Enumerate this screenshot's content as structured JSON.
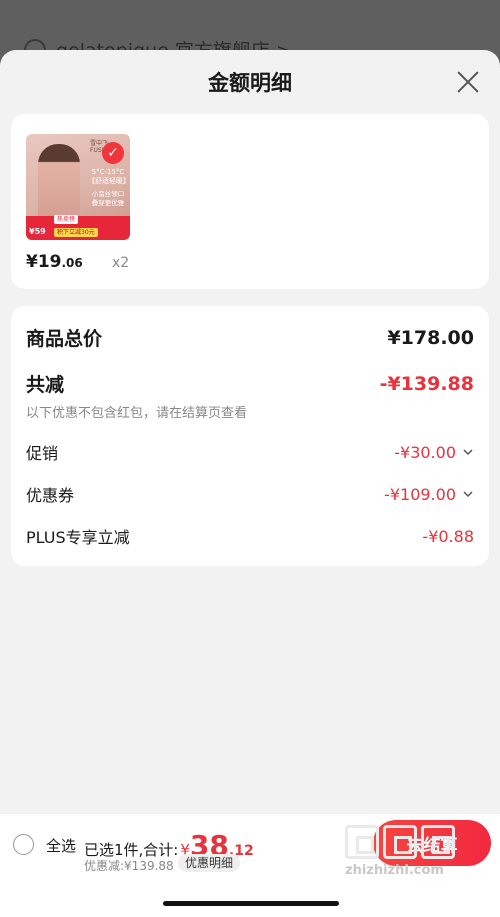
{
  "background": {
    "store_name": "gelatopique 官方旗舰店 >"
  },
  "sheet": {
    "title": "金额明细"
  },
  "product": {
    "thumbnail": {
      "brand": "雪中飞 FUSIRAGE",
      "temp": "5°C-15°C 【舒适轻暖】",
      "tags": "小蛮丝领口 叠穿更优雅",
      "strip_top": "热卖榜",
      "badge_price": "¥59",
      "promo": "积下立减30元"
    },
    "price_int": "¥19",
    "price_dec": ".06",
    "quantity": "x2"
  },
  "summary": {
    "total_label": "商品总价",
    "total_value": "¥178.00",
    "reduce_label": "共减",
    "reduce_value": "-¥139.88",
    "note": "以下优惠不包含红包，请在结算页查看",
    "promo_label": "促销",
    "promo_value": "-¥30.00",
    "coupon_label": "优惠券",
    "coupon_value": "-¥109.00",
    "plus_label": "PLUS专享立减",
    "plus_value": "-¥0.88"
  },
  "bottom_bar": {
    "select_all": "全选",
    "selected_text": "已选1件,合计:",
    "sum_currency": "¥",
    "sum_int": "38",
    "sum_dec": ".12",
    "discount_text": "优惠减:¥139.88",
    "detail_button": "优惠明细",
    "checkout_button": "去结算"
  },
  "watermark": {
    "url": "zhizhizhi.com"
  },
  "colors": {
    "accent_red": "#e8323c",
    "sheet_bg": "#f2f2f2",
    "overlay": "#5c5c5c"
  },
  "icons": [
    "close-icon",
    "check-icon",
    "chevron-down-icon",
    "radio-icon"
  ]
}
